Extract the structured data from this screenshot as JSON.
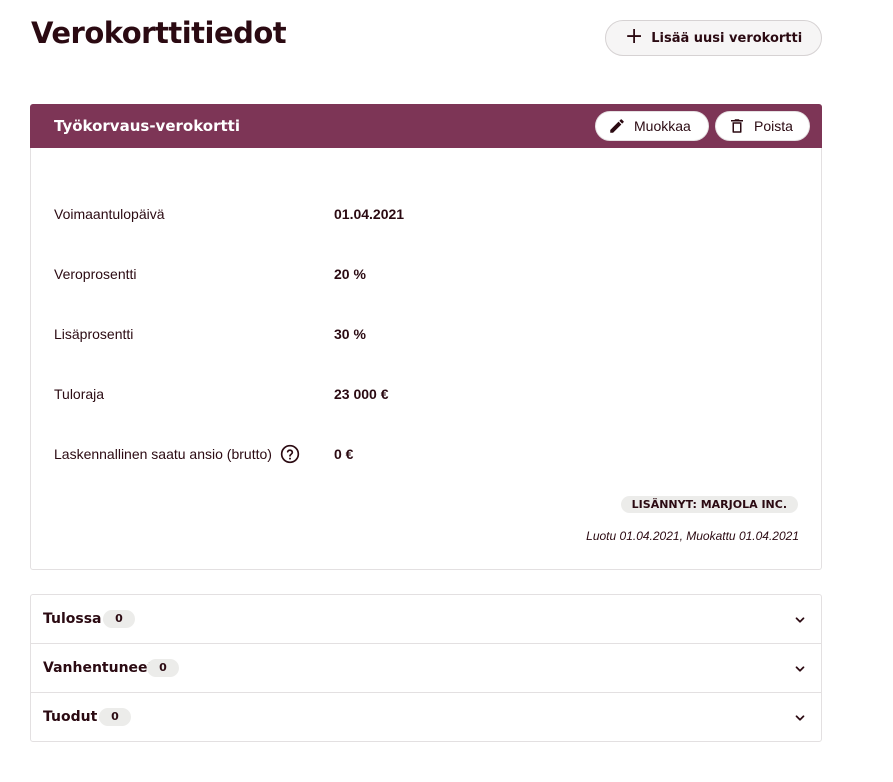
{
  "page": {
    "title": "Verokorttitiedot",
    "add_button_label": "Lisää uusi verokortti"
  },
  "card": {
    "title": "Työkorvaus-verokortti",
    "edit_label": "Muokkaa",
    "delete_label": "Poista",
    "rows": [
      {
        "label": "Voimaantulopäivä",
        "value": "01.04.2021"
      },
      {
        "label": "Veroprosentti",
        "value": "20 %"
      },
      {
        "label": "Lisäprosentti",
        "value": "30 %"
      },
      {
        "label": "Tuloraja",
        "value": "23 000 €"
      },
      {
        "label": "Laskennallinen saatu ansio (brutto)",
        "value": "0 €"
      }
    ],
    "added_by": "LISÄNNYT: MARJOLA INC.",
    "timestamps": "Luotu 01.04.2021, Muokattu 01.04.2021"
  },
  "accordion": [
    {
      "label": "Tulossa",
      "count": "0"
    },
    {
      "label": "Vanhentuneet",
      "count": "0"
    },
    {
      "label": "Tuodut",
      "count": "0"
    }
  ],
  "colors": {
    "header_bg": "#7d3556",
    "text": "#2b0a12",
    "badge_bg": "#ececea"
  },
  "icons": {
    "add": "plus-icon",
    "edit": "pencil-icon",
    "delete": "trash-icon",
    "help": "question-circle-icon",
    "expand": "chevron-down-icon"
  }
}
